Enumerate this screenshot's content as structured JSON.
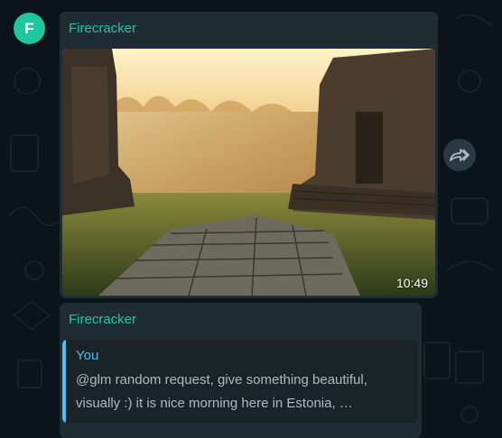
{
  "messages": [
    {
      "sender": "Firecracker",
      "avatar_letter": "F",
      "avatar_color": "#1fc7a0",
      "image_description_icon": "photo-temple-sunrise",
      "timestamp": "10:49"
    },
    {
      "sender": "Firecracker",
      "quoted": {
        "author": "You",
        "text": "@glm random request, give something beautiful, visually :) it is nice morning here in Estonia, …"
      }
    }
  ],
  "forward_icon": "forward-arrow-icon",
  "colors": {
    "background": "#0b141a",
    "bubble": "#202c33",
    "accent": "#1fc7a0",
    "quote_accent": "#53bdeb"
  }
}
